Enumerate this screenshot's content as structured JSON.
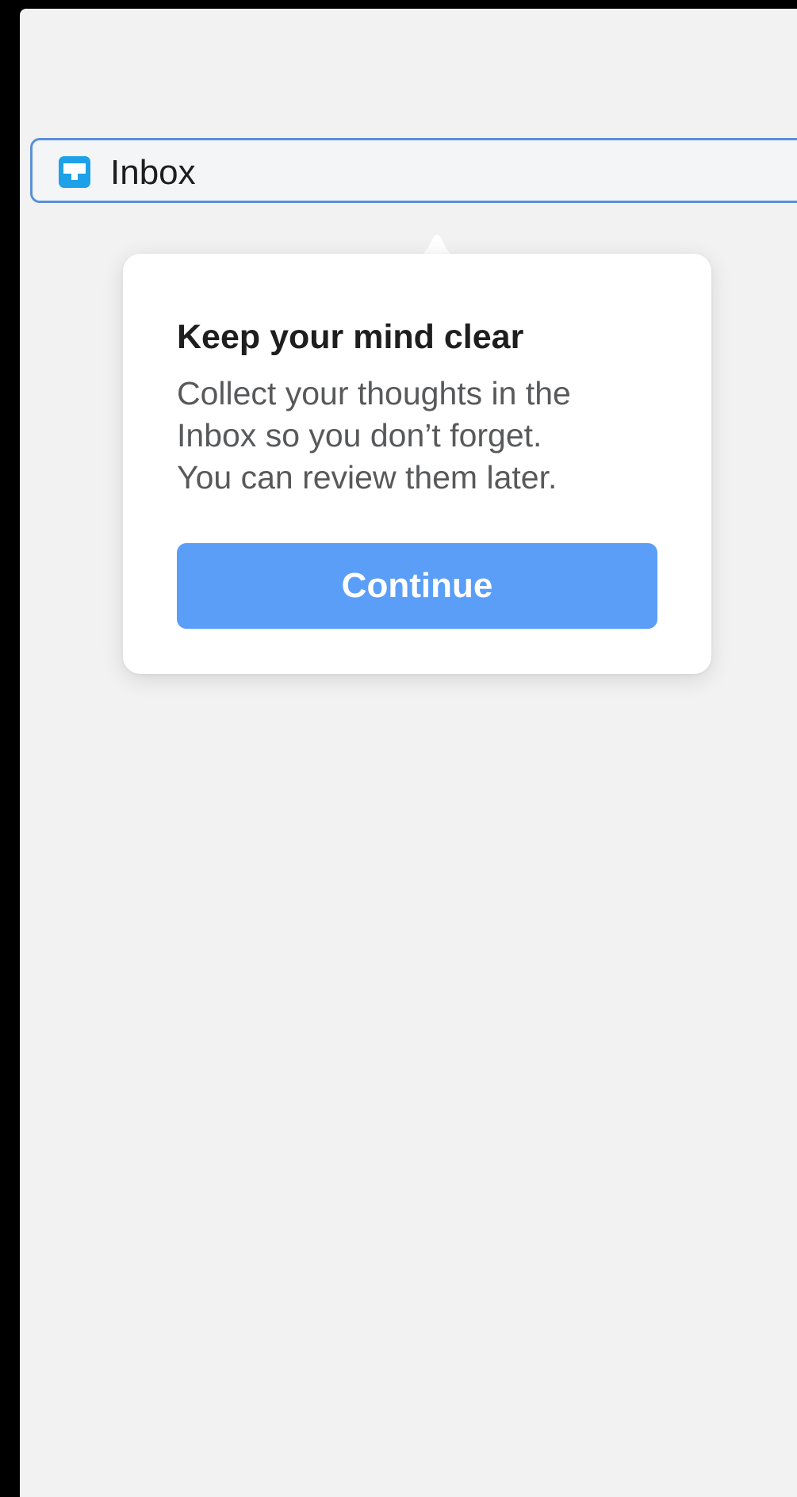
{
  "inbox": {
    "label": "Inbox",
    "icon": "inbox-tray-icon",
    "icon_color": "#1ea1e8",
    "border_color": "#5b8fd9"
  },
  "tooltip": {
    "title": "Keep your mind clear",
    "body": "Collect your thoughts in the\nInbox so you don’t forget.\nYou can review them later.",
    "button_label": "Continue",
    "button_color": "#5b9ef7"
  }
}
